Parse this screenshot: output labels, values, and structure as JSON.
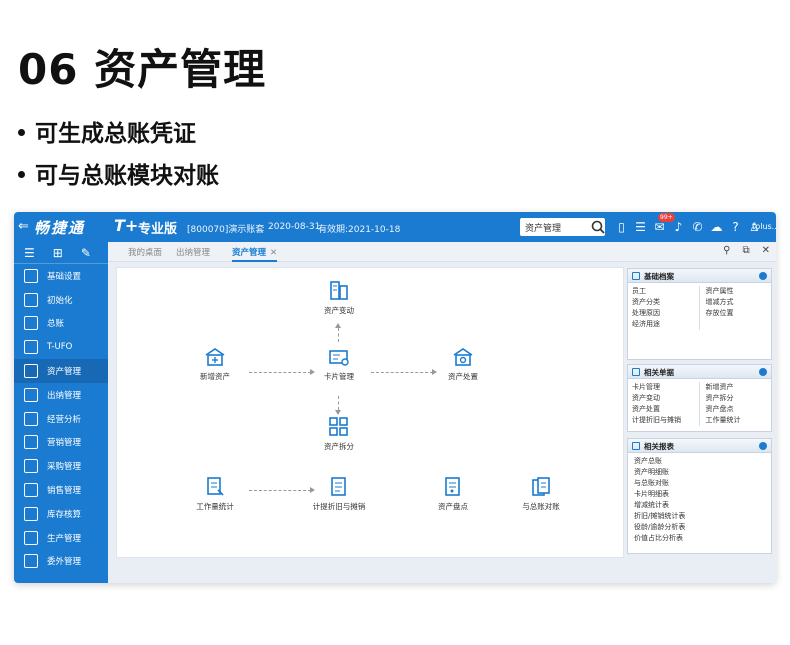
{
  "slide": {
    "title": "06 资产管理",
    "bullets": [
      "可生成总账凭证",
      "可与总账模块对账"
    ]
  },
  "topbar": {
    "back_glyph": "⇐",
    "brand": "畅捷通",
    "product": "T+",
    "edition": "专业版",
    "account": "[800070]演示账套",
    "date": "2020-08-31",
    "valid_until": "有效期:2021-10-18",
    "search_value": "资产管理",
    "notification_badge": "99+",
    "user": "tplus..."
  },
  "sidebar": {
    "items": [
      {
        "label": "基础设置",
        "icon": "settings-icon"
      },
      {
        "label": "初始化",
        "icon": "init-icon"
      },
      {
        "label": "总账",
        "icon": "ledger-icon"
      },
      {
        "label": "T-UFO",
        "icon": "ufo-icon"
      },
      {
        "label": "资产管理",
        "icon": "asset-icon",
        "active": true
      },
      {
        "label": "出纳管理",
        "icon": "cashier-icon"
      },
      {
        "label": "经营分析",
        "icon": "analysis-icon"
      },
      {
        "label": "营销管理",
        "icon": "marketing-icon"
      },
      {
        "label": "采购管理",
        "icon": "purchase-icon"
      },
      {
        "label": "销售管理",
        "icon": "sales-icon"
      },
      {
        "label": "库存核算",
        "icon": "inventory-icon"
      },
      {
        "label": "生产管理",
        "icon": "production-icon"
      },
      {
        "label": "委外管理",
        "icon": "outsource-icon"
      }
    ]
  },
  "tabs": [
    {
      "label": "我的桌面"
    },
    {
      "label": "出纳管理"
    },
    {
      "label": "资产管理",
      "active": true
    }
  ],
  "flow": {
    "asset_change": "资产变动",
    "add_asset": "新增资产",
    "card_mgmt": "卡片管理",
    "asset_disposal": "资产处置",
    "asset_split": "资产拆分",
    "workload_stats": "工作量统计",
    "depreciation": "计提折旧与摊销",
    "asset_inventory": "资产盘点",
    "ledger_reconcile": "与总账对账"
  },
  "panels": {
    "basic": {
      "title": "基础档案",
      "left": [
        "员工",
        "资产分类",
        "处理原因",
        "经济用途"
      ],
      "right": [
        "资产属性",
        "增减方式",
        "存放位置"
      ]
    },
    "docs": {
      "title": "相关单据",
      "left": [
        "卡片管理",
        "资产变动",
        "资产处置",
        "计提折旧与摊销"
      ],
      "right": [
        "新增资产",
        "资产拆分",
        "资产盘点",
        "工作量统计"
      ]
    },
    "reports": {
      "title": "相关报表",
      "items": [
        "资产总账",
        "资产明细账",
        "与总账对账",
        "卡片明细表",
        "增减统计表",
        "折旧/摊销统计表",
        "役龄/逾龄分析表",
        "价值占比分析表"
      ]
    }
  },
  "colors": {
    "primary": "#1a7bd1",
    "sidebar_active": "#1769b5",
    "badge": "#e8413c"
  }
}
